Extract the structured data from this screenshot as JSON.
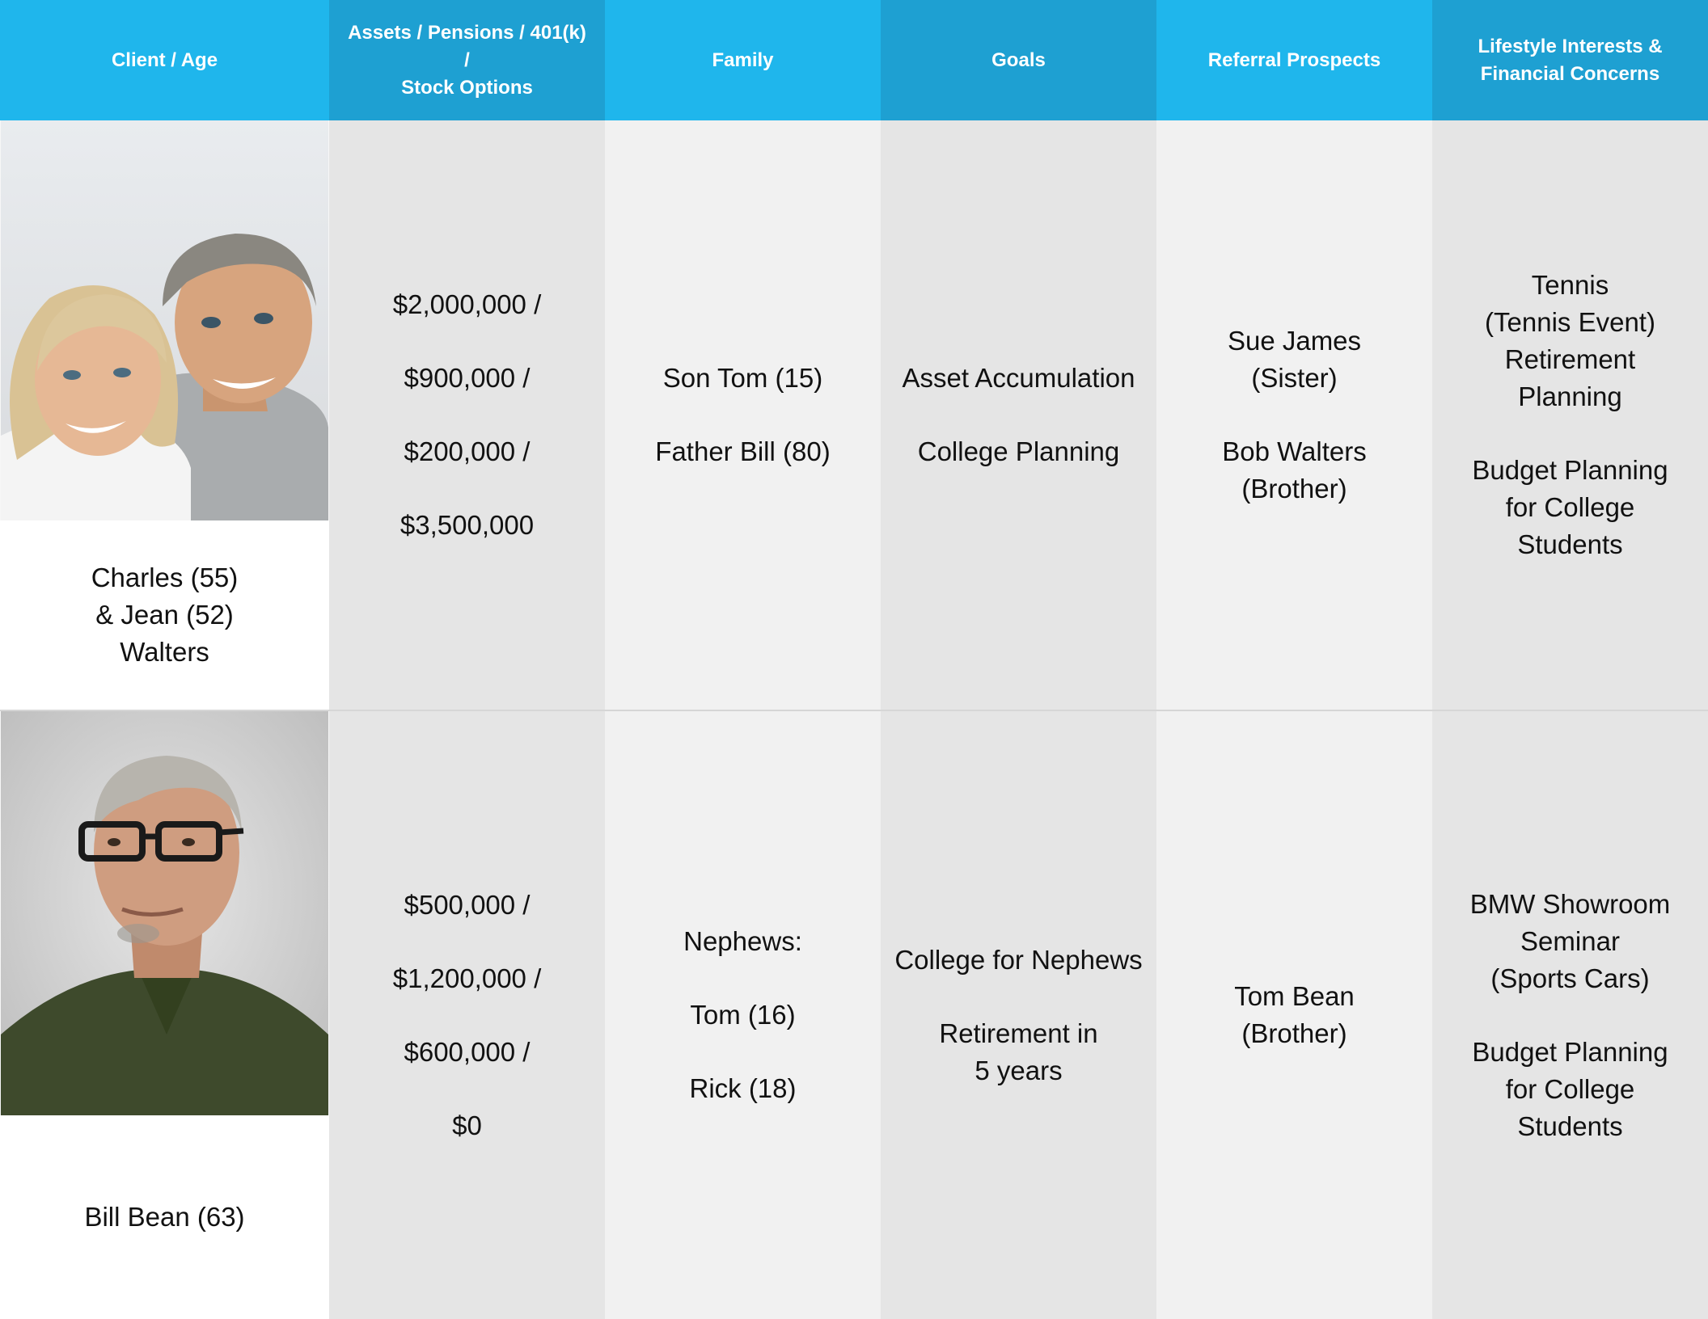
{
  "headers": [
    "Client / Age",
    "Assets / Pensions / 401(k) /\nStock Options",
    "Family",
    "Goals",
    "Referral Prospects",
    "Lifestyle Interests &\nFinancial Concerns"
  ],
  "rows": [
    {
      "client": [
        "Charles (55)",
        "& Jean (52)",
        "Walters"
      ],
      "photo": "couple-photo",
      "assets": [
        "$2,000,000 /",
        "$900,000 /",
        "$200,000 /",
        "$3,500,000"
      ],
      "family": [
        "Son Tom (15)",
        "Father Bill (80)"
      ],
      "goals": [
        "Asset Accumulation",
        "College Planning"
      ],
      "referrals": [
        "Sue James",
        "(Sister)",
        "Bob Walters",
        "(Brother)"
      ],
      "lifestyle": [
        "Tennis",
        "(Tennis Event)",
        "Retirement",
        "Planning",
        "Budget Planning",
        "for College",
        "Students"
      ]
    },
    {
      "client": [
        "Bill Bean (63)"
      ],
      "photo": "man-with-glasses-photo",
      "assets": [
        "$500,000 /",
        "$1,200,000 /",
        "$600,000 /",
        "$0"
      ],
      "family": [
        "Nephews:",
        "Tom (16)",
        "Rick (18)"
      ],
      "goals": [
        "College for Nephews",
        "Retirement in",
        "5 years"
      ],
      "referrals": [
        "Tom Bean",
        "(Brother)"
      ],
      "lifestyle": [
        "BMW Showroom",
        "Seminar",
        "(Sports Cars)",
        "Budget Planning",
        "for College",
        "Students"
      ]
    }
  ]
}
